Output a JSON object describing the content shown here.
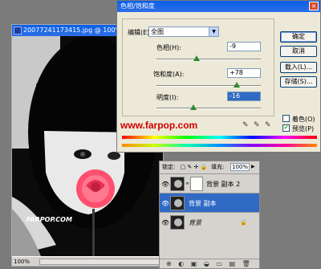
{
  "document": {
    "title": "20077241173415.jpg @ 100%",
    "zoom": "100%",
    "watermark": "FARPOP.COM"
  },
  "dialog": {
    "title": "色相/饱和度",
    "edit_label": "编辑(E):",
    "edit_value": "全图",
    "hue_label": "色相(H):",
    "hue_value": "-9",
    "sat_label": "饱和度(A):",
    "sat_value": "+78",
    "light_label": "明度(I):",
    "light_value": "-16",
    "ok": "确定",
    "cancel": "取消",
    "load": "载入(L)...",
    "save": "存储(S)...",
    "colorize": "着色(O)",
    "preview": "预览(P)",
    "preview_checked": true,
    "colorize_checked": false,
    "url": "www.farpop.com"
  },
  "layers": {
    "lock_label": "锁定:",
    "fill_label": "填充:",
    "fill_value": "100%",
    "items": [
      {
        "name": "背景 副本 2",
        "active": false,
        "has_mask": true
      },
      {
        "name": "背景 副本",
        "active": true,
        "has_mask": false
      },
      {
        "name": "背景",
        "active": false,
        "has_mask": false,
        "italic": true
      }
    ]
  },
  "colors": {
    "accent": "#316ac5",
    "titlebar": "#0a5fe8",
    "url_red": "#d30000",
    "rose": "#ff4f6e"
  }
}
